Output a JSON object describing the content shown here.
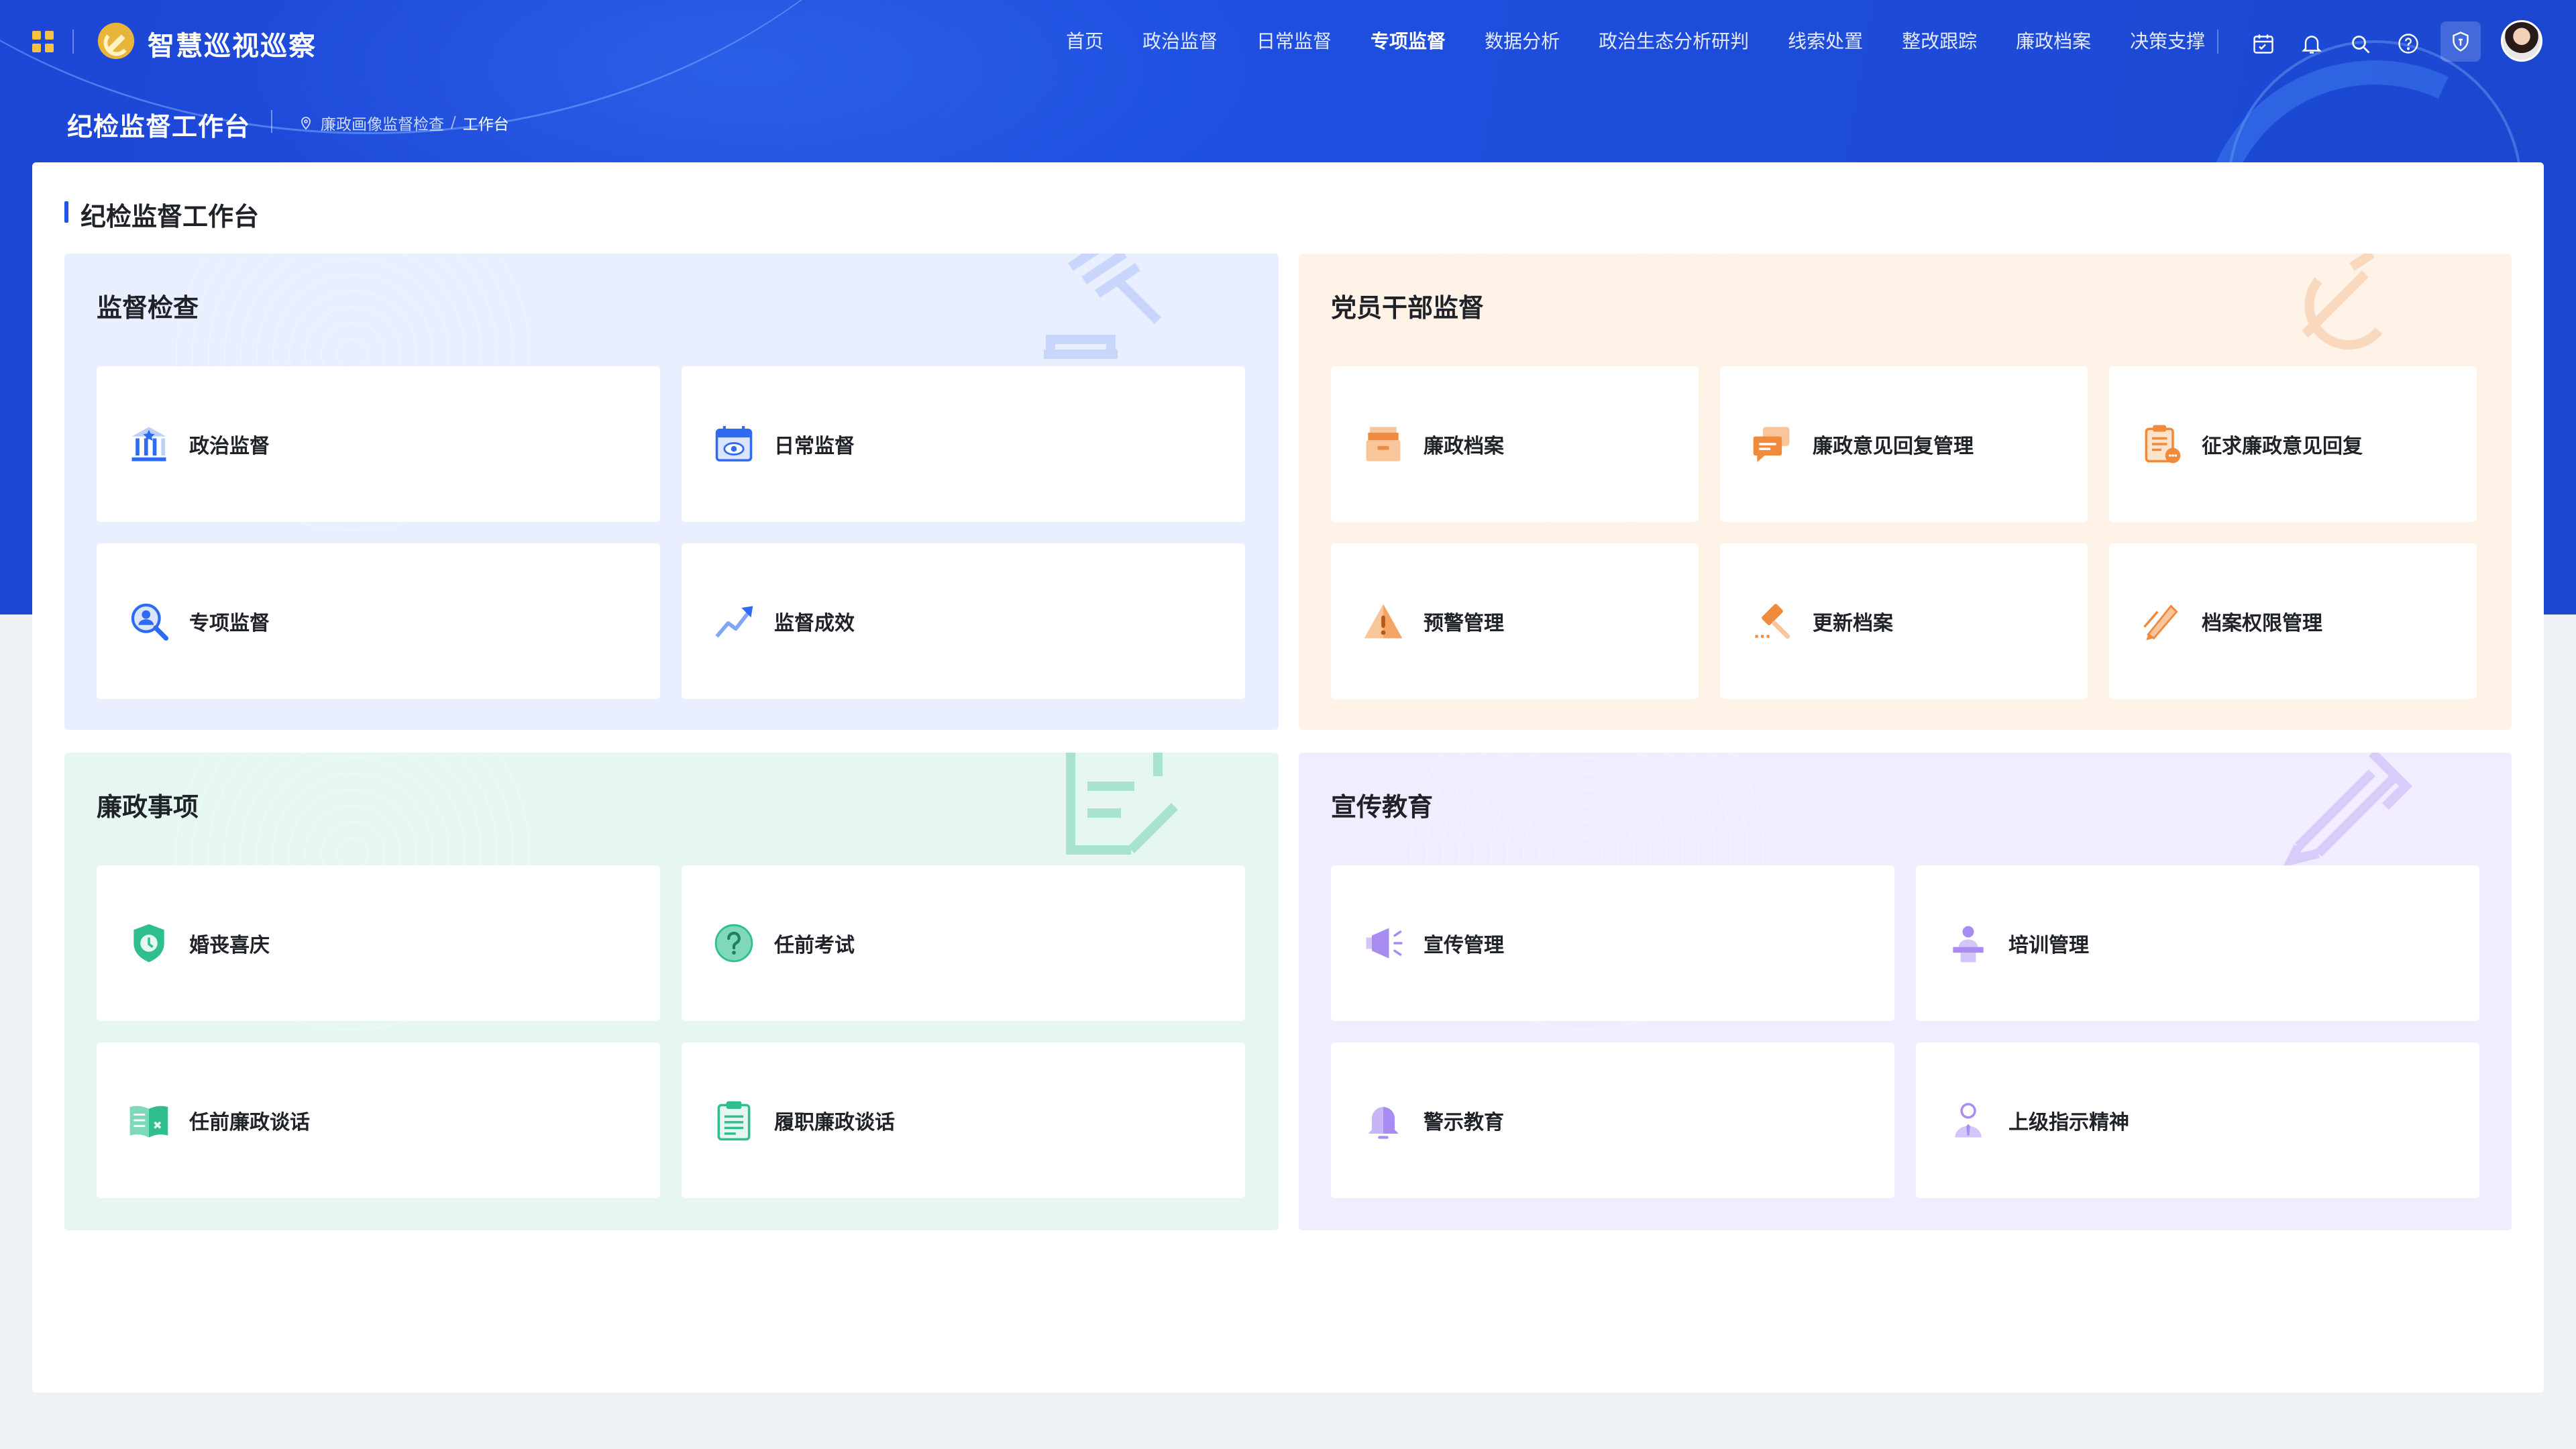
{
  "app": {
    "title": "智慧巡视巡察"
  },
  "nav": {
    "items": [
      {
        "label": "首页"
      },
      {
        "label": "政治监督"
      },
      {
        "label": "日常监督"
      },
      {
        "label": "专项监督",
        "active": true
      },
      {
        "label": "数据分析"
      },
      {
        "label": "政治生态分析研判"
      },
      {
        "label": "线索处置"
      },
      {
        "label": "整改跟踪"
      },
      {
        "label": "廉政档案"
      },
      {
        "label": "决策支撑"
      }
    ],
    "icons": [
      "calendar-icon",
      "bell-icon",
      "search-icon",
      "help-icon",
      "shield-icon"
    ]
  },
  "header": {
    "page_title": "纪检监督工作台",
    "breadcrumb": [
      "廉政画像监督检查",
      "工作台"
    ]
  },
  "panel": {
    "title": "纪检监督工作台"
  },
  "sections": [
    {
      "title": "监督检查",
      "color": "#e9efff",
      "cards": [
        {
          "label": "政治监督",
          "icon": "government-building-icon"
        },
        {
          "label": "日常监督",
          "icon": "calendar-eye-icon"
        },
        {
          "label": "专项监督",
          "icon": "magnifier-person-icon"
        },
        {
          "label": "监督成效",
          "icon": "trend-arrow-icon"
        }
      ]
    },
    {
      "title": "党员干部监督",
      "color": "#fff2e6",
      "cards": [
        {
          "label": "廉政档案",
          "icon": "archive-box-icon"
        },
        {
          "label": "廉政意见回复管理",
          "icon": "chat-bubbles-icon"
        },
        {
          "label": "征求廉政意见回复",
          "icon": "clipboard-comment-icon"
        },
        {
          "label": "预警管理",
          "icon": "warning-triangle-icon"
        },
        {
          "label": "更新档案",
          "icon": "gavel-refresh-icon"
        },
        {
          "label": "档案权限管理",
          "icon": "pencil-edit-icon"
        }
      ]
    },
    {
      "title": "廉政事项",
      "color": "#e6f7f1",
      "cards": [
        {
          "label": "婚丧喜庆",
          "icon": "shield-clock-icon"
        },
        {
          "label": "任前考试",
          "icon": "question-circle-icon"
        },
        {
          "label": "任前廉政谈话",
          "icon": "open-book-icon"
        },
        {
          "label": "履职廉政谈话",
          "icon": "clipboard-list-icon"
        }
      ]
    },
    {
      "title": "宣传教育",
      "color": "#f1ecff",
      "cards": [
        {
          "label": "宣传管理",
          "icon": "megaphone-icon"
        },
        {
          "label": "培训管理",
          "icon": "lectern-person-icon"
        },
        {
          "label": "警示教育",
          "icon": "bell-alert-icon"
        },
        {
          "label": "上级指示精神",
          "icon": "leader-person-icon"
        }
      ]
    }
  ],
  "colors": {
    "brand_blue": "#1e4fe0",
    "accent_yellow": "#f5c242",
    "blue_icon": "#2f6bf0",
    "orange_icon": "#f08a3c",
    "green_icon": "#2fbf8f",
    "purple_icon": "#a98cf2"
  }
}
